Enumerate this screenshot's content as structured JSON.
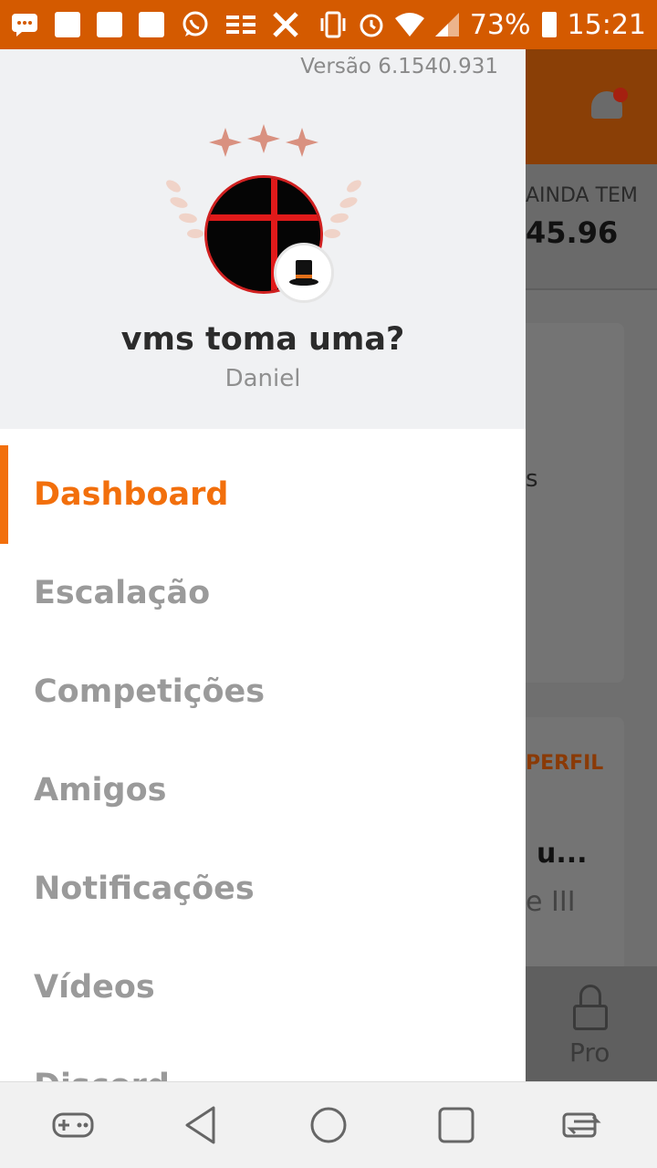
{
  "status_bar": {
    "battery": "73%",
    "time": "15:21"
  },
  "drawer": {
    "version": "Versão 6.1540.931",
    "team_name": "vms toma uma?",
    "owner_name": "Daniel",
    "menu": [
      {
        "label": "Dashboard",
        "active": true
      },
      {
        "label": "Escalação",
        "active": false
      },
      {
        "label": "Competições",
        "active": false
      },
      {
        "label": "Amigos",
        "active": false
      },
      {
        "label": "Notificações",
        "active": false
      },
      {
        "label": "Vídeos",
        "active": false
      },
      {
        "label": "Discord",
        "active": false
      }
    ]
  },
  "background": {
    "card1_label": "AINDA TEM",
    "card1_value": "45.96",
    "card2_text": "s",
    "card3_label": "PERFIL",
    "card3_title": "u...",
    "card3_sub": "e III",
    "tab_label": "Pro"
  },
  "colors": {
    "accent": "#f26f0c",
    "status_bar": "#d45a00"
  }
}
